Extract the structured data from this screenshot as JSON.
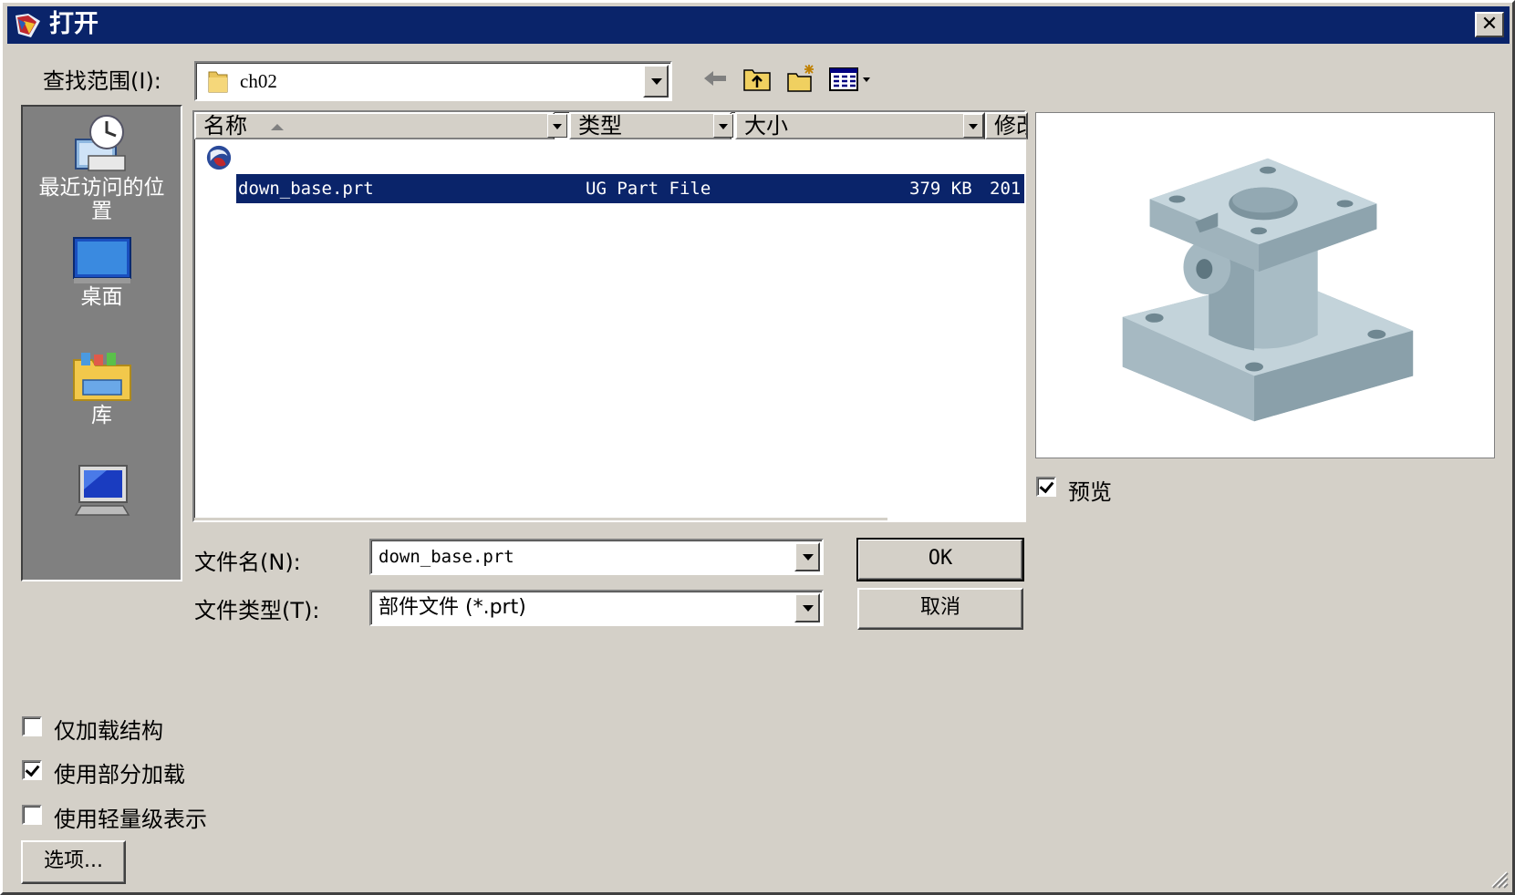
{
  "window": {
    "title": "打开",
    "close_label": "✕"
  },
  "look_in": {
    "label": "查找范围(I):",
    "value": "ch02"
  },
  "toolbar": {
    "icons": [
      "back-arrow-icon",
      "up-folder-icon",
      "new-folder-icon",
      "view-menu-icon"
    ]
  },
  "places": [
    {
      "label": "最近访问的位置",
      "icon": "recent-places-icon"
    },
    {
      "label": "桌面",
      "icon": "desktop-icon"
    },
    {
      "label": "库",
      "icon": "libraries-icon"
    },
    {
      "label": "",
      "icon": "computer-icon"
    }
  ],
  "file_list": {
    "columns": [
      "名称",
      "类型",
      "大小",
      "修改"
    ],
    "rows": [
      {
        "name": "down_base.prt",
        "type": "UG Part File",
        "size": "379 KB",
        "modified": "201",
        "selected": true
      }
    ]
  },
  "file_name": {
    "label": "文件名(N):",
    "value": "down_base.prt"
  },
  "file_type": {
    "label": "文件类型(T):",
    "value": "部件文件 (*.prt)"
  },
  "buttons": {
    "ok": "OK",
    "cancel": "取消",
    "options": "选项..."
  },
  "preview": {
    "label": "预览",
    "checked": true
  },
  "options": [
    {
      "label": "仅加载结构",
      "checked": false
    },
    {
      "label": "使用部分加载",
      "checked": true
    },
    {
      "label": "使用轻量级表示",
      "checked": false
    }
  ],
  "colors": {
    "title_bar": "#0a246a",
    "dialog_bg": "#d4d0c8",
    "selection": "#0a246a",
    "model": "#a9bcc5"
  }
}
